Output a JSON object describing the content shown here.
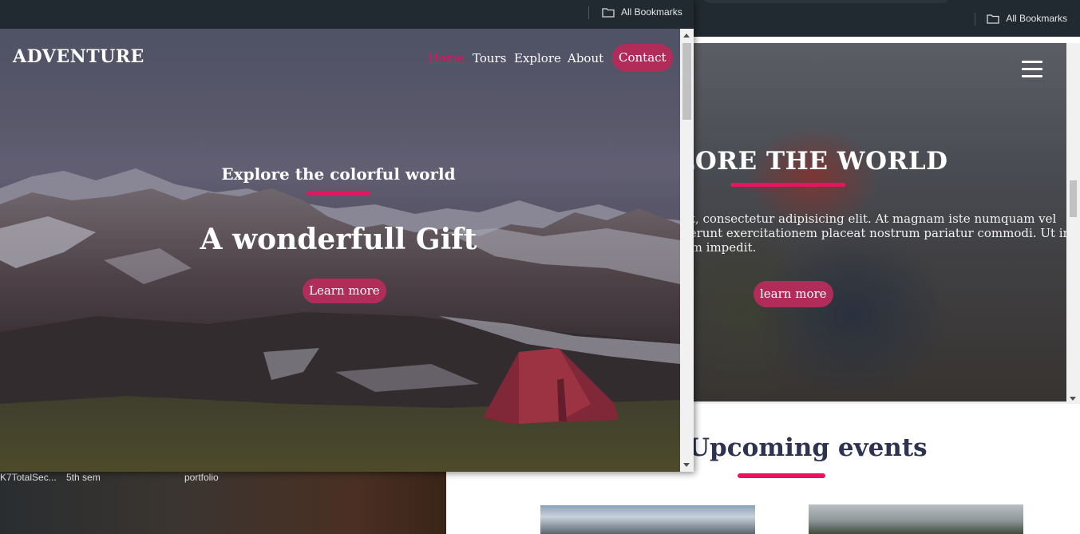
{
  "colors": {
    "accent": "#e8145f",
    "button_bg": "#b22c5a",
    "nav_active": "#e0145c",
    "heading_dark": "#2d3451",
    "chrome_bg": "#202a30"
  },
  "background_window": {
    "bookmarks_label": "All Bookmarks",
    "menu_icon": "hamburger-menu-icon",
    "hero_title": "LORE THE WORLD",
    "hero_text_lines": [
      "et, consectetur adipisicing elit. At magnam iste numquam vel",
      "serunt exercitationem placeat nostrum pariatur commodi. Ut in",
      "um impedit."
    ],
    "learn_more": "learn more",
    "events_title": "Upcoming events"
  },
  "foreground_window": {
    "bookmarks_label": "All Bookmarks",
    "logo": "ADVENTURE",
    "nav": {
      "home": "Home",
      "tours": "Tours",
      "explore": "Explore",
      "about": "About",
      "contact": "Contact"
    },
    "hero_subtitle": "Explore the colorful world",
    "hero_title": "A wonderfull Gift",
    "learn_more": "Learn more"
  },
  "desktop": {
    "items": [
      "K7TotalSec...",
      "5th sem",
      "portfolio"
    ]
  }
}
